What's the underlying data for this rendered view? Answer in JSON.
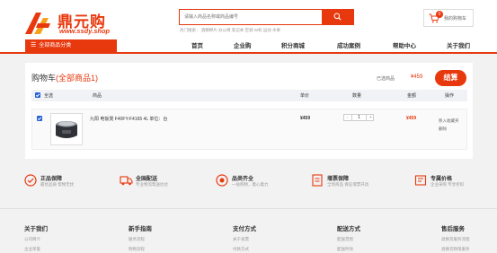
{
  "brand": {
    "name": "鼎元购",
    "url": "www.ssdy.shop",
    "accent_color": "#e8380d"
  },
  "search": {
    "placeholder": "请输入商品名称或商品编号",
    "hot_words": "热门搜索：  酒精棉片 办公椅 笔记本 空调 W机 运动 水果"
  },
  "mini_cart": {
    "count": "0",
    "label": "我的购物车"
  },
  "nav": {
    "category_button": "全部商品分类",
    "items": [
      "首页",
      "企业购",
      "积分商城",
      "成功案例",
      "帮助中心",
      "关于我们"
    ]
  },
  "cart": {
    "title": "购物车",
    "count_text": "(全部商品1)",
    "selected_label": "已选商品",
    "selected_total": "¥459",
    "checkout_label": "结算",
    "columns": {
      "select_all": "全选",
      "product": "商品",
      "unit_price": "单价",
      "quantity": "数量",
      "amount": "金额",
      "actions": "操作"
    },
    "items": [
      {
        "name": "九阳 电饭煲 F40FY-F4165 4L  单位：台",
        "unit_price": "¥459",
        "quantity": "1",
        "line_total": "¥459",
        "action_favorite": "移入收藏夹",
        "action_delete": "删除"
      }
    ]
  },
  "features": [
    {
      "title": "正品保障",
      "subtitle": "最优品质 帮物无忧",
      "icon": "checkmark-circle-icon"
    },
    {
      "title": "全国配送",
      "subtitle": "专业物流帮送达达",
      "icon": "truck-icon"
    },
    {
      "title": "品类齐全",
      "subtitle": "一站购物，着心着力",
      "icon": "brand-circle-icon"
    },
    {
      "title": "增票保障",
      "subtitle": "全场商品 保证增票开具",
      "icon": "invoice-icon"
    },
    {
      "title": "专属价格",
      "subtitle": "企业采购 专享折扣",
      "icon": "price-tag-icon"
    }
  ],
  "footer": {
    "columns": [
      {
        "title": "关于我们",
        "links": [
          "公司简介",
          "企业荣誉"
        ]
      },
      {
        "title": "新手指南",
        "links": [
          "服务流程",
          "购物流程"
        ]
      },
      {
        "title": "支付方式",
        "links": [
          "关于发票",
          "付款方式"
        ]
      },
      {
        "title": "配送方式",
        "links": [
          "配送范围",
          "配送时效"
        ]
      },
      {
        "title": "售后服务",
        "links": [
          "退换货服务流程",
          "退换货政策服务"
        ]
      }
    ]
  }
}
